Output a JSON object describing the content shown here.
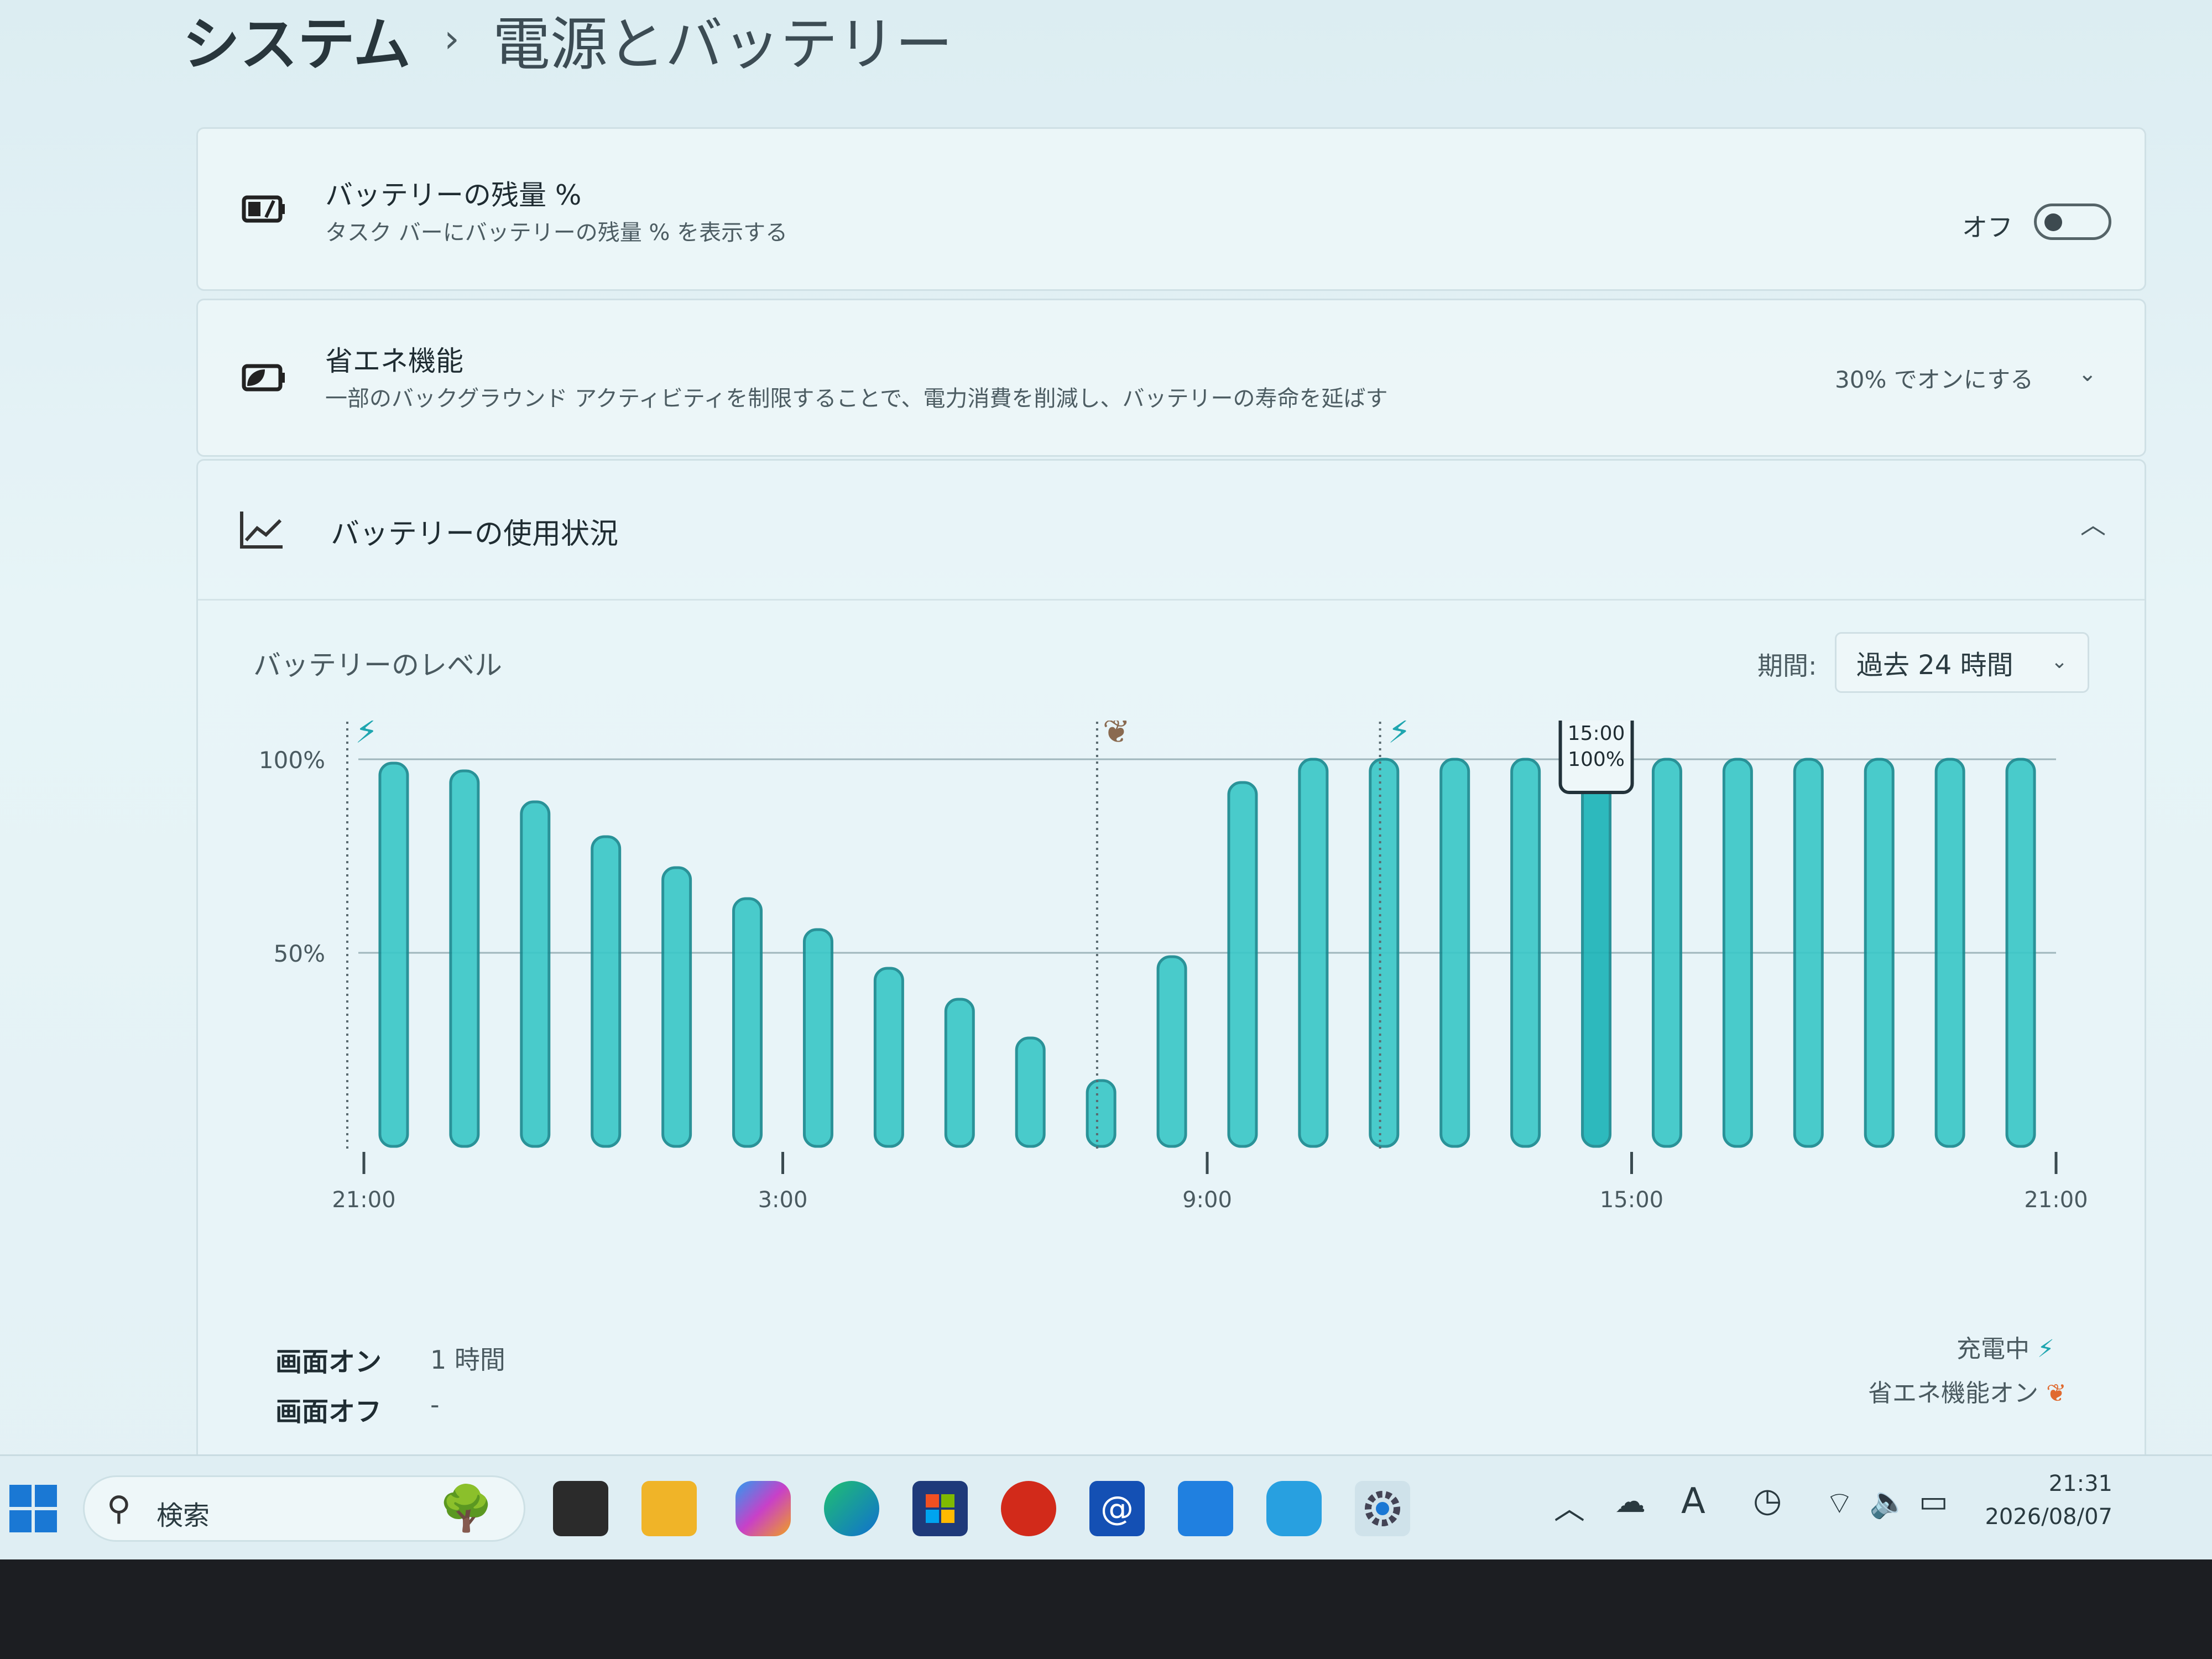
{
  "breadcrumb": {
    "parent": "システム",
    "separator": "›",
    "current": "電源とバッテリー"
  },
  "battery_percent": {
    "title": "バッテリーの残量 %",
    "description": "タスク バーにバッテリーの残量 % を表示する",
    "toggle_label": "オフ",
    "toggle_state": "off"
  },
  "energy_saver": {
    "title": "省エネ機能",
    "description": "一部のバックグラウンド アクティビティを制限することで、電力消費を削減し、バッテリーの寿命を延ばす",
    "value": "30% でオンにする"
  },
  "battery_usage": {
    "title": "バッテリーの使用状況",
    "level_title": "バッテリーのレベル",
    "period_label": "期間:",
    "period_value": "過去 24 時間",
    "tooltip_time": "15:00",
    "tooltip_value": "100%",
    "legend_charging": "充電中",
    "legend_saver": "省エネ機能オン",
    "stats": [
      {
        "label": "画面オン",
        "value": "1 時間"
      },
      {
        "label": "画面オフ",
        "value": "-"
      }
    ]
  },
  "chart_data": {
    "type": "bar",
    "title": "バッテリーのレベル",
    "yticks": [
      "100%",
      "50%"
    ],
    "ylim": [
      0,
      100
    ],
    "xticks": [
      "21:00",
      "3:00",
      "9:00",
      "15:00",
      "21:00"
    ],
    "values": [
      99,
      97,
      89,
      80,
      72,
      64,
      56,
      46,
      38,
      28,
      17,
      49,
      94,
      100,
      100,
      100,
      100,
      100,
      100,
      100,
      100,
      100,
      100,
      100
    ],
    "highlight_index": 17,
    "grid": true,
    "colors": {
      "bar": "#3cc8c8",
      "bar_highlight": "#1eb4b8",
      "bar_stroke": "#1a8a90"
    }
  },
  "taskbar": {
    "search_placeholder": "検索",
    "apps": [
      "task-view-icon",
      "file-explorer-icon",
      "copilot-icon",
      "edge-icon",
      "store-icon",
      "app-red-icon",
      "mail-icon",
      "photos-icon",
      "dev-preview-icon",
      "settings-icon"
    ],
    "time": "21:31",
    "date": "2026/08/07"
  }
}
